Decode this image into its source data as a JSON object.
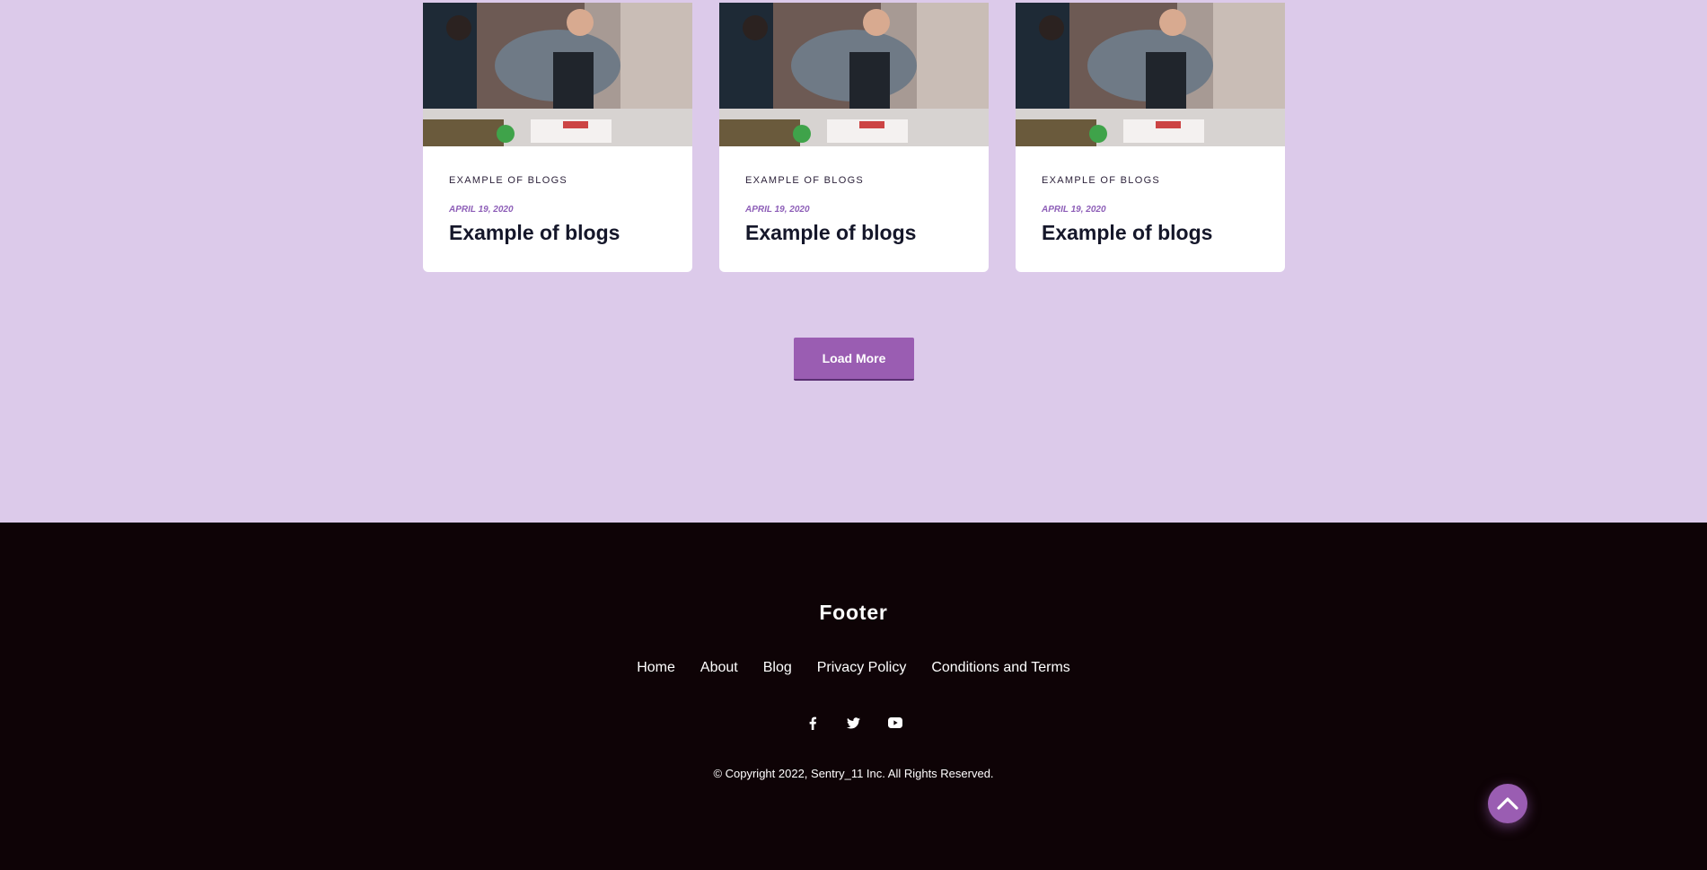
{
  "blog": {
    "cards": [
      {
        "category": "EXAMPLE OF BLOGS",
        "date": "APRIL 19, 2020",
        "title": "Example of blogs",
        "image": "chef-cooking-photo"
      },
      {
        "category": "EXAMPLE OF BLOGS",
        "date": "APRIL 19, 2020",
        "title": "Example of blogs",
        "image": "chef-cooking-photo"
      },
      {
        "category": "EXAMPLE OF BLOGS",
        "date": "APRIL 19, 2020",
        "title": "Example of blogs",
        "image": "chef-cooking-photo"
      }
    ],
    "load_more_label": "Load More"
  },
  "footer": {
    "title": "Footer",
    "nav": [
      "Home",
      "About",
      "Blog",
      "Privacy Policy",
      "Conditions and Terms"
    ],
    "socials": [
      "facebook-icon",
      "twitter-icon",
      "youtube-icon"
    ],
    "copyright": "© Copyright 2022, Sentry_11 Inc. All Rights Reserved."
  },
  "back_to_top_icon": "chevron-up-icon",
  "colors": {
    "page_background": "#dccaea",
    "accent": "#9a5db2",
    "footer_background": "#0e0306",
    "date_text": "#8e5fb8"
  }
}
